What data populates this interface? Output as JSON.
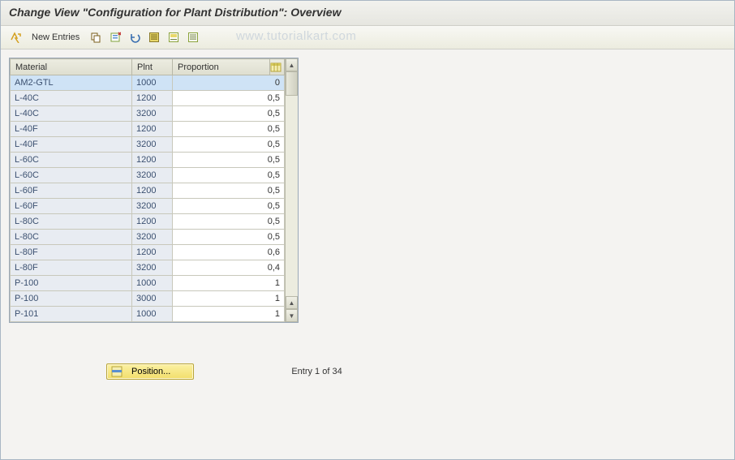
{
  "header": {
    "title": "Change View \"Configuration for Plant Distribution\": Overview"
  },
  "watermark": "www.tutorialkart.com",
  "toolbar": {
    "new_entries_label": "New Entries",
    "icons": {
      "other_view": "other-view-icon",
      "copy": "copy-icon",
      "delete": "delete-icon",
      "undo": "undo-icon",
      "select_all": "select-all-icon",
      "select_block": "select-block-icon",
      "deselect_all": "deselect-all-icon"
    }
  },
  "table": {
    "columns": [
      "Material",
      "Plnt",
      "Proportion"
    ],
    "config_icon": "table-settings-icon",
    "rows": [
      {
        "material": "AM2-GTL",
        "plnt": "1000",
        "proportion": "0",
        "selected": true
      },
      {
        "material": "L-40C",
        "plnt": "1200",
        "proportion": "0,5"
      },
      {
        "material": "L-40C",
        "plnt": "3200",
        "proportion": "0,5"
      },
      {
        "material": "L-40F",
        "plnt": "1200",
        "proportion": "0,5"
      },
      {
        "material": "L-40F",
        "plnt": "3200",
        "proportion": "0,5"
      },
      {
        "material": "L-60C",
        "plnt": "1200",
        "proportion": "0,5"
      },
      {
        "material": "L-60C",
        "plnt": "3200",
        "proportion": "0,5"
      },
      {
        "material": "L-60F",
        "plnt": "1200",
        "proportion": "0,5"
      },
      {
        "material": "L-60F",
        "plnt": "3200",
        "proportion": "0,5"
      },
      {
        "material": "L-80C",
        "plnt": "1200",
        "proportion": "0,5"
      },
      {
        "material": "L-80C",
        "plnt": "3200",
        "proportion": "0,5"
      },
      {
        "material": "L-80F",
        "plnt": "1200",
        "proportion": "0,6"
      },
      {
        "material": "L-80F",
        "plnt": "3200",
        "proportion": "0,4"
      },
      {
        "material": "P-100",
        "plnt": "1000",
        "proportion": "1"
      },
      {
        "material": "P-100",
        "plnt": "3000",
        "proportion": "1"
      },
      {
        "material": "P-101",
        "plnt": "1000",
        "proportion": "1"
      }
    ]
  },
  "footer": {
    "position_label": "Position...",
    "entry_status": "Entry 1 of 34"
  }
}
